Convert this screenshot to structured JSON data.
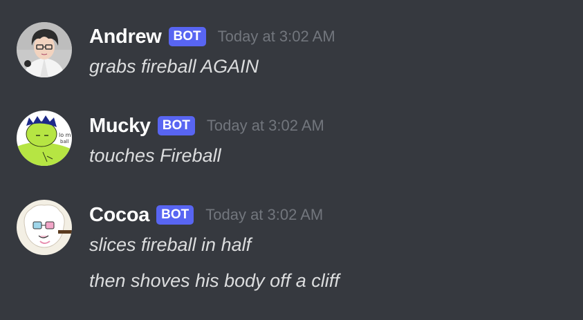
{
  "messages": [
    {
      "username": "Andrew",
      "tag": "BOT",
      "timestamp": "Today at 3:02 AM",
      "avatar_icon": "anime-boy-glasses-avatar",
      "lines": [
        "grabs fireball AGAIN"
      ]
    },
    {
      "username": "Mucky",
      "tag": "BOT",
      "timestamp": "Today at 3:02 AM",
      "avatar_icon": "green-character-avatar",
      "lines": [
        "touches Fireball"
      ]
    },
    {
      "username": "Cocoa",
      "tag": "BOT",
      "timestamp": "Today at 3:02 AM",
      "avatar_icon": "fluffy-white-creature-avatar",
      "lines": [
        "slices fireball in half",
        "then shoves his body off a cliff"
      ]
    }
  ],
  "colors": {
    "background": "#36393f",
    "username": "#ffffff",
    "bot_tag": "#5865f2",
    "timestamp": "#72767d",
    "message_text": "#dcddde"
  }
}
